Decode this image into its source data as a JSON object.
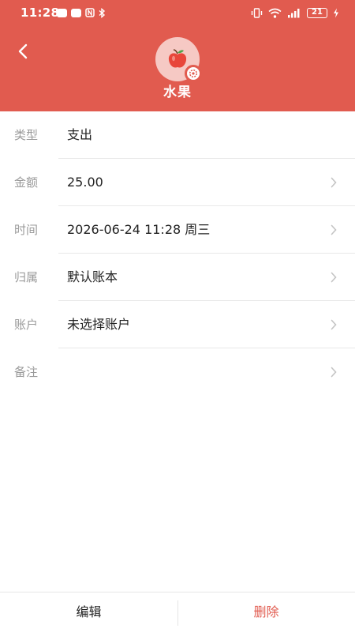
{
  "status_bar": {
    "time": "11:28",
    "battery": "21",
    "icons": [
      "notification-badge-icon",
      "notification-badge-icon",
      "nfc-icon",
      "bluetooth-icon",
      "vibrate-icon",
      "wifi-icon",
      "signal-icon",
      "battery-icon",
      "charging-icon"
    ]
  },
  "header": {
    "category_name": "水果",
    "accent_color": "#E15B4F",
    "avatar_color": "#F6C9C4"
  },
  "rows": [
    {
      "label": "类型",
      "value": "支出",
      "has_chevron": false
    },
    {
      "label": "金额",
      "value": "25.00",
      "has_chevron": true
    },
    {
      "label": "时间",
      "value": "2026-06-24 11:28 周三",
      "has_chevron": true
    },
    {
      "label": "归属",
      "value": "默认账本",
      "has_chevron": true
    },
    {
      "label": "账户",
      "value": "未选择账户",
      "has_chevron": true
    },
    {
      "label": "备注",
      "value": "",
      "has_chevron": true
    }
  ],
  "bottom": {
    "edit_label": "编辑",
    "delete_label": "删除"
  }
}
